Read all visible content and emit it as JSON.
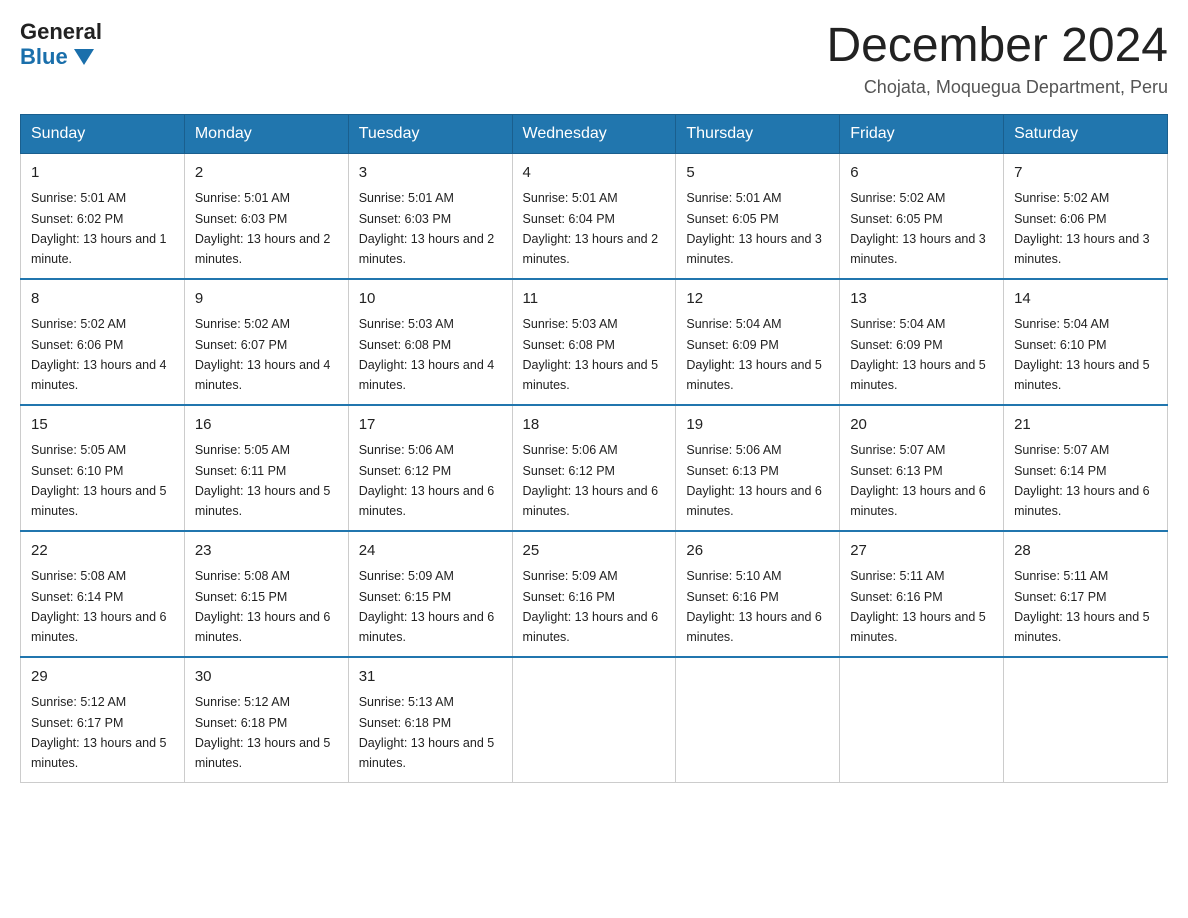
{
  "header": {
    "logo_general": "General",
    "logo_blue": "Blue",
    "month_title": "December 2024",
    "location": "Chojata, Moquegua Department, Peru"
  },
  "weekdays": [
    "Sunday",
    "Monday",
    "Tuesday",
    "Wednesday",
    "Thursday",
    "Friday",
    "Saturday"
  ],
  "weeks": [
    [
      {
        "day": "1",
        "sunrise": "5:01 AM",
        "sunset": "6:02 PM",
        "daylight": "13 hours and 1 minute."
      },
      {
        "day": "2",
        "sunrise": "5:01 AM",
        "sunset": "6:03 PM",
        "daylight": "13 hours and 2 minutes."
      },
      {
        "day": "3",
        "sunrise": "5:01 AM",
        "sunset": "6:03 PM",
        "daylight": "13 hours and 2 minutes."
      },
      {
        "day": "4",
        "sunrise": "5:01 AM",
        "sunset": "6:04 PM",
        "daylight": "13 hours and 2 minutes."
      },
      {
        "day": "5",
        "sunrise": "5:01 AM",
        "sunset": "6:05 PM",
        "daylight": "13 hours and 3 minutes."
      },
      {
        "day": "6",
        "sunrise": "5:02 AM",
        "sunset": "6:05 PM",
        "daylight": "13 hours and 3 minutes."
      },
      {
        "day": "7",
        "sunrise": "5:02 AM",
        "sunset": "6:06 PM",
        "daylight": "13 hours and 3 minutes."
      }
    ],
    [
      {
        "day": "8",
        "sunrise": "5:02 AM",
        "sunset": "6:06 PM",
        "daylight": "13 hours and 4 minutes."
      },
      {
        "day": "9",
        "sunrise": "5:02 AM",
        "sunset": "6:07 PM",
        "daylight": "13 hours and 4 minutes."
      },
      {
        "day": "10",
        "sunrise": "5:03 AM",
        "sunset": "6:08 PM",
        "daylight": "13 hours and 4 minutes."
      },
      {
        "day": "11",
        "sunrise": "5:03 AM",
        "sunset": "6:08 PM",
        "daylight": "13 hours and 5 minutes."
      },
      {
        "day": "12",
        "sunrise": "5:04 AM",
        "sunset": "6:09 PM",
        "daylight": "13 hours and 5 minutes."
      },
      {
        "day": "13",
        "sunrise": "5:04 AM",
        "sunset": "6:09 PM",
        "daylight": "13 hours and 5 minutes."
      },
      {
        "day": "14",
        "sunrise": "5:04 AM",
        "sunset": "6:10 PM",
        "daylight": "13 hours and 5 minutes."
      }
    ],
    [
      {
        "day": "15",
        "sunrise": "5:05 AM",
        "sunset": "6:10 PM",
        "daylight": "13 hours and 5 minutes."
      },
      {
        "day": "16",
        "sunrise": "5:05 AM",
        "sunset": "6:11 PM",
        "daylight": "13 hours and 5 minutes."
      },
      {
        "day": "17",
        "sunrise": "5:06 AM",
        "sunset": "6:12 PM",
        "daylight": "13 hours and 6 minutes."
      },
      {
        "day": "18",
        "sunrise": "5:06 AM",
        "sunset": "6:12 PM",
        "daylight": "13 hours and 6 minutes."
      },
      {
        "day": "19",
        "sunrise": "5:06 AM",
        "sunset": "6:13 PM",
        "daylight": "13 hours and 6 minutes."
      },
      {
        "day": "20",
        "sunrise": "5:07 AM",
        "sunset": "6:13 PM",
        "daylight": "13 hours and 6 minutes."
      },
      {
        "day": "21",
        "sunrise": "5:07 AM",
        "sunset": "6:14 PM",
        "daylight": "13 hours and 6 minutes."
      }
    ],
    [
      {
        "day": "22",
        "sunrise": "5:08 AM",
        "sunset": "6:14 PM",
        "daylight": "13 hours and 6 minutes."
      },
      {
        "day": "23",
        "sunrise": "5:08 AM",
        "sunset": "6:15 PM",
        "daylight": "13 hours and 6 minutes."
      },
      {
        "day": "24",
        "sunrise": "5:09 AM",
        "sunset": "6:15 PM",
        "daylight": "13 hours and 6 minutes."
      },
      {
        "day": "25",
        "sunrise": "5:09 AM",
        "sunset": "6:16 PM",
        "daylight": "13 hours and 6 minutes."
      },
      {
        "day": "26",
        "sunrise": "5:10 AM",
        "sunset": "6:16 PM",
        "daylight": "13 hours and 6 minutes."
      },
      {
        "day": "27",
        "sunrise": "5:11 AM",
        "sunset": "6:16 PM",
        "daylight": "13 hours and 5 minutes."
      },
      {
        "day": "28",
        "sunrise": "5:11 AM",
        "sunset": "6:17 PM",
        "daylight": "13 hours and 5 minutes."
      }
    ],
    [
      {
        "day": "29",
        "sunrise": "5:12 AM",
        "sunset": "6:17 PM",
        "daylight": "13 hours and 5 minutes."
      },
      {
        "day": "30",
        "sunrise": "5:12 AM",
        "sunset": "6:18 PM",
        "daylight": "13 hours and 5 minutes."
      },
      {
        "day": "31",
        "sunrise": "5:13 AM",
        "sunset": "6:18 PM",
        "daylight": "13 hours and 5 minutes."
      },
      null,
      null,
      null,
      null
    ]
  ]
}
